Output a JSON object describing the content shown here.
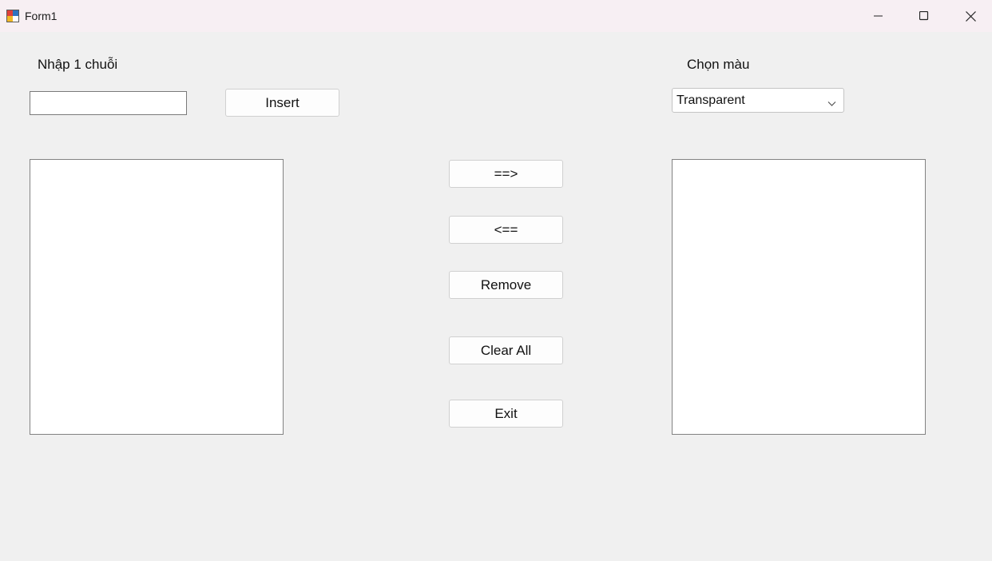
{
  "window": {
    "title": "Form1",
    "icon": "form-icon",
    "controls": [
      "minimize-icon",
      "maximize-icon",
      "close-icon"
    ]
  },
  "input_section": {
    "label": "Nhập 1 chuỗi",
    "input_value": "",
    "insert_label": "Insert"
  },
  "color_section": {
    "label": "Chọn màu",
    "selected": "Transparent"
  },
  "left_list": {
    "items": []
  },
  "right_list": {
    "items": []
  },
  "actions": {
    "move_right": "==>",
    "move_left": "<==",
    "remove": "Remove",
    "clear_all": "Clear All",
    "exit": "Exit"
  }
}
